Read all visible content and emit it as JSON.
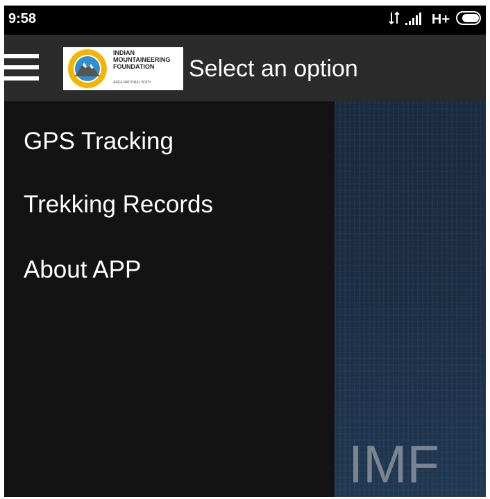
{
  "status_bar": {
    "time": "9:58",
    "network": "H+",
    "icons": [
      "data-transfer-icon",
      "signal-icon",
      "battery-icon"
    ]
  },
  "toolbar": {
    "menu_icon": "hamburger-menu-icon",
    "logo": {
      "line1": "INDIAN",
      "line2": "MOUNTAINEERING",
      "line3": "FOUNDATION",
      "sub": "AREA NATIONAL BODY"
    },
    "title": "Select an option"
  },
  "drawer": {
    "items": [
      {
        "label": "GPS Tracking"
      },
      {
        "label": "Trekking Records"
      },
      {
        "label": "About APP"
      }
    ]
  },
  "background": {
    "text": "IMF"
  },
  "colors": {
    "status_bar": "#000000",
    "toolbar": "#2b2b2b",
    "drawer": "#131313",
    "background_panel": "#1b2d44",
    "text": "#ffffff"
  }
}
